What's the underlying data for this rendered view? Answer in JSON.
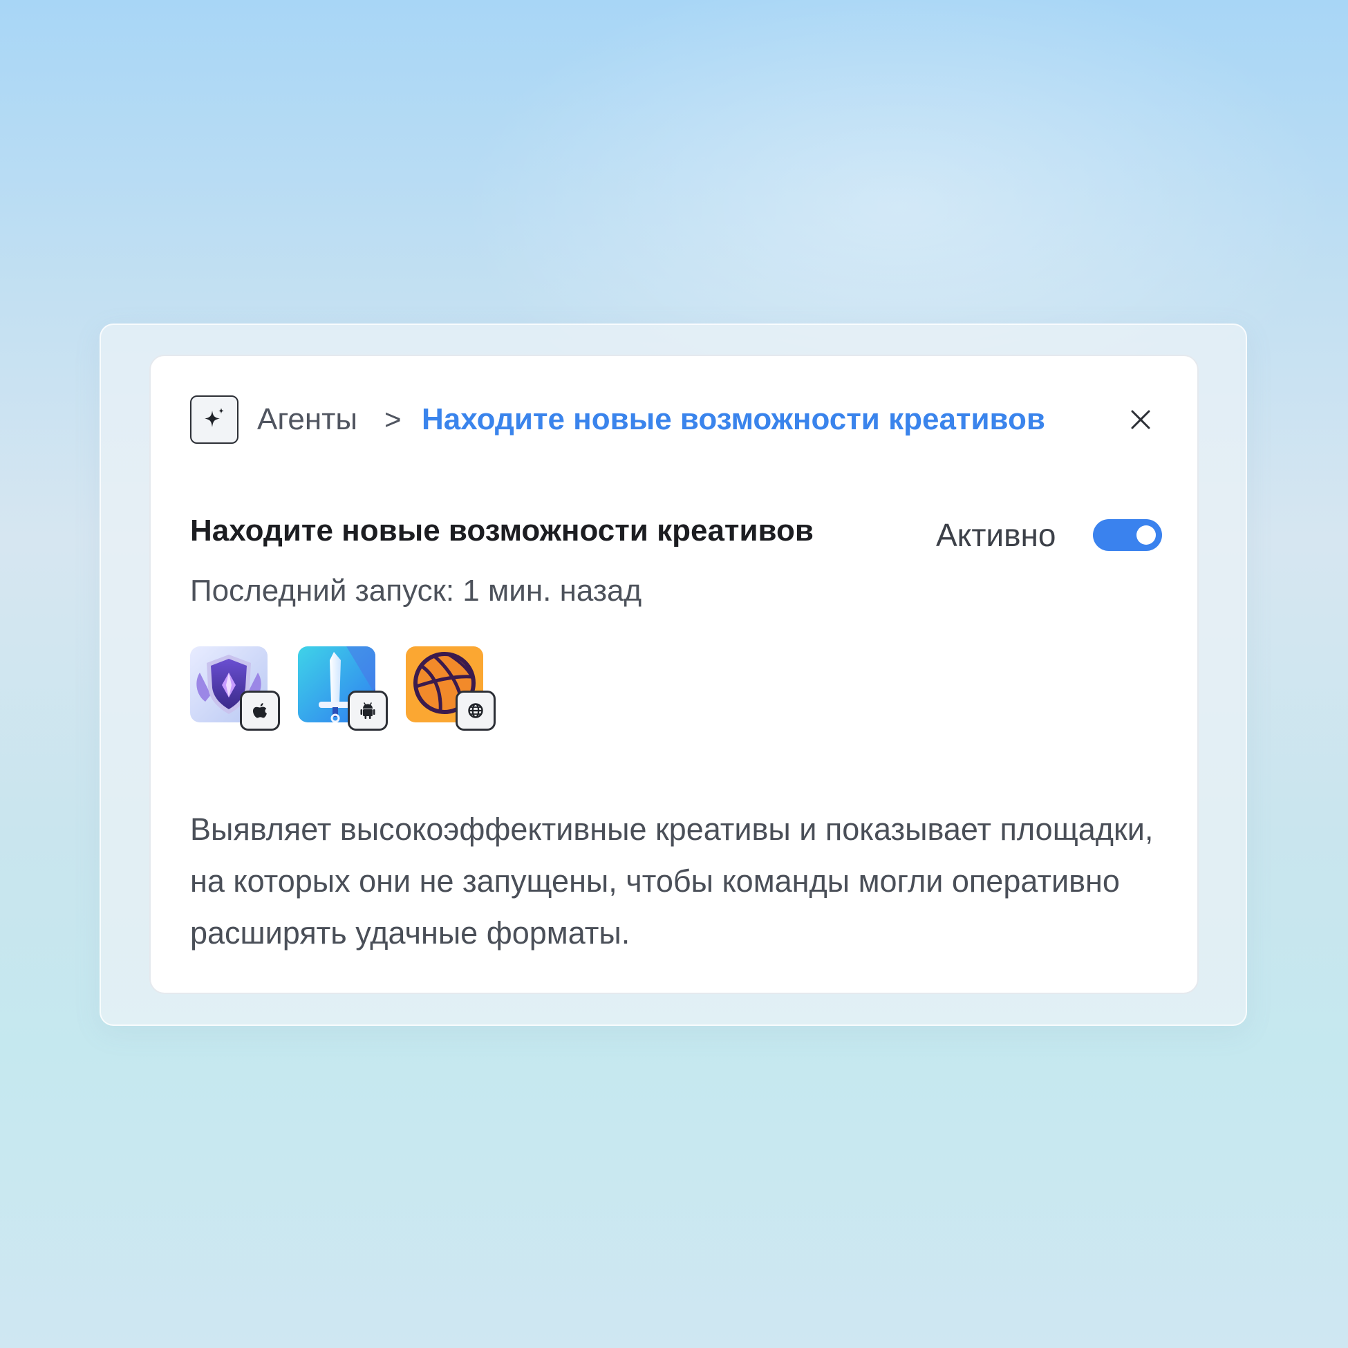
{
  "breadcrumb": {
    "root": "Агенты",
    "separator": ">",
    "current": "Находите новые возможности креативов"
  },
  "agent": {
    "title": "Находите новые возможности креативов",
    "status_label": "Активно",
    "active": true,
    "last_run": "Последний запуск: 1 мин. назад",
    "description": "Выявляет высокоэффективные креативы и показывает площадки, на которых они не запущены, чтобы команды могли оперативно расширять удачные форматы."
  },
  "apps": [
    {
      "icon": "shield-game-icon",
      "platform": "apple-icon"
    },
    {
      "icon": "sword-game-icon",
      "platform": "android-icon"
    },
    {
      "icon": "basketball-game-icon",
      "platform": "globe-icon"
    }
  ],
  "colors": {
    "accent": "#3a84ec",
    "toggle_on": "#3a82ee",
    "title_text": "#1c1d21",
    "body_text": "#4a4f58"
  }
}
